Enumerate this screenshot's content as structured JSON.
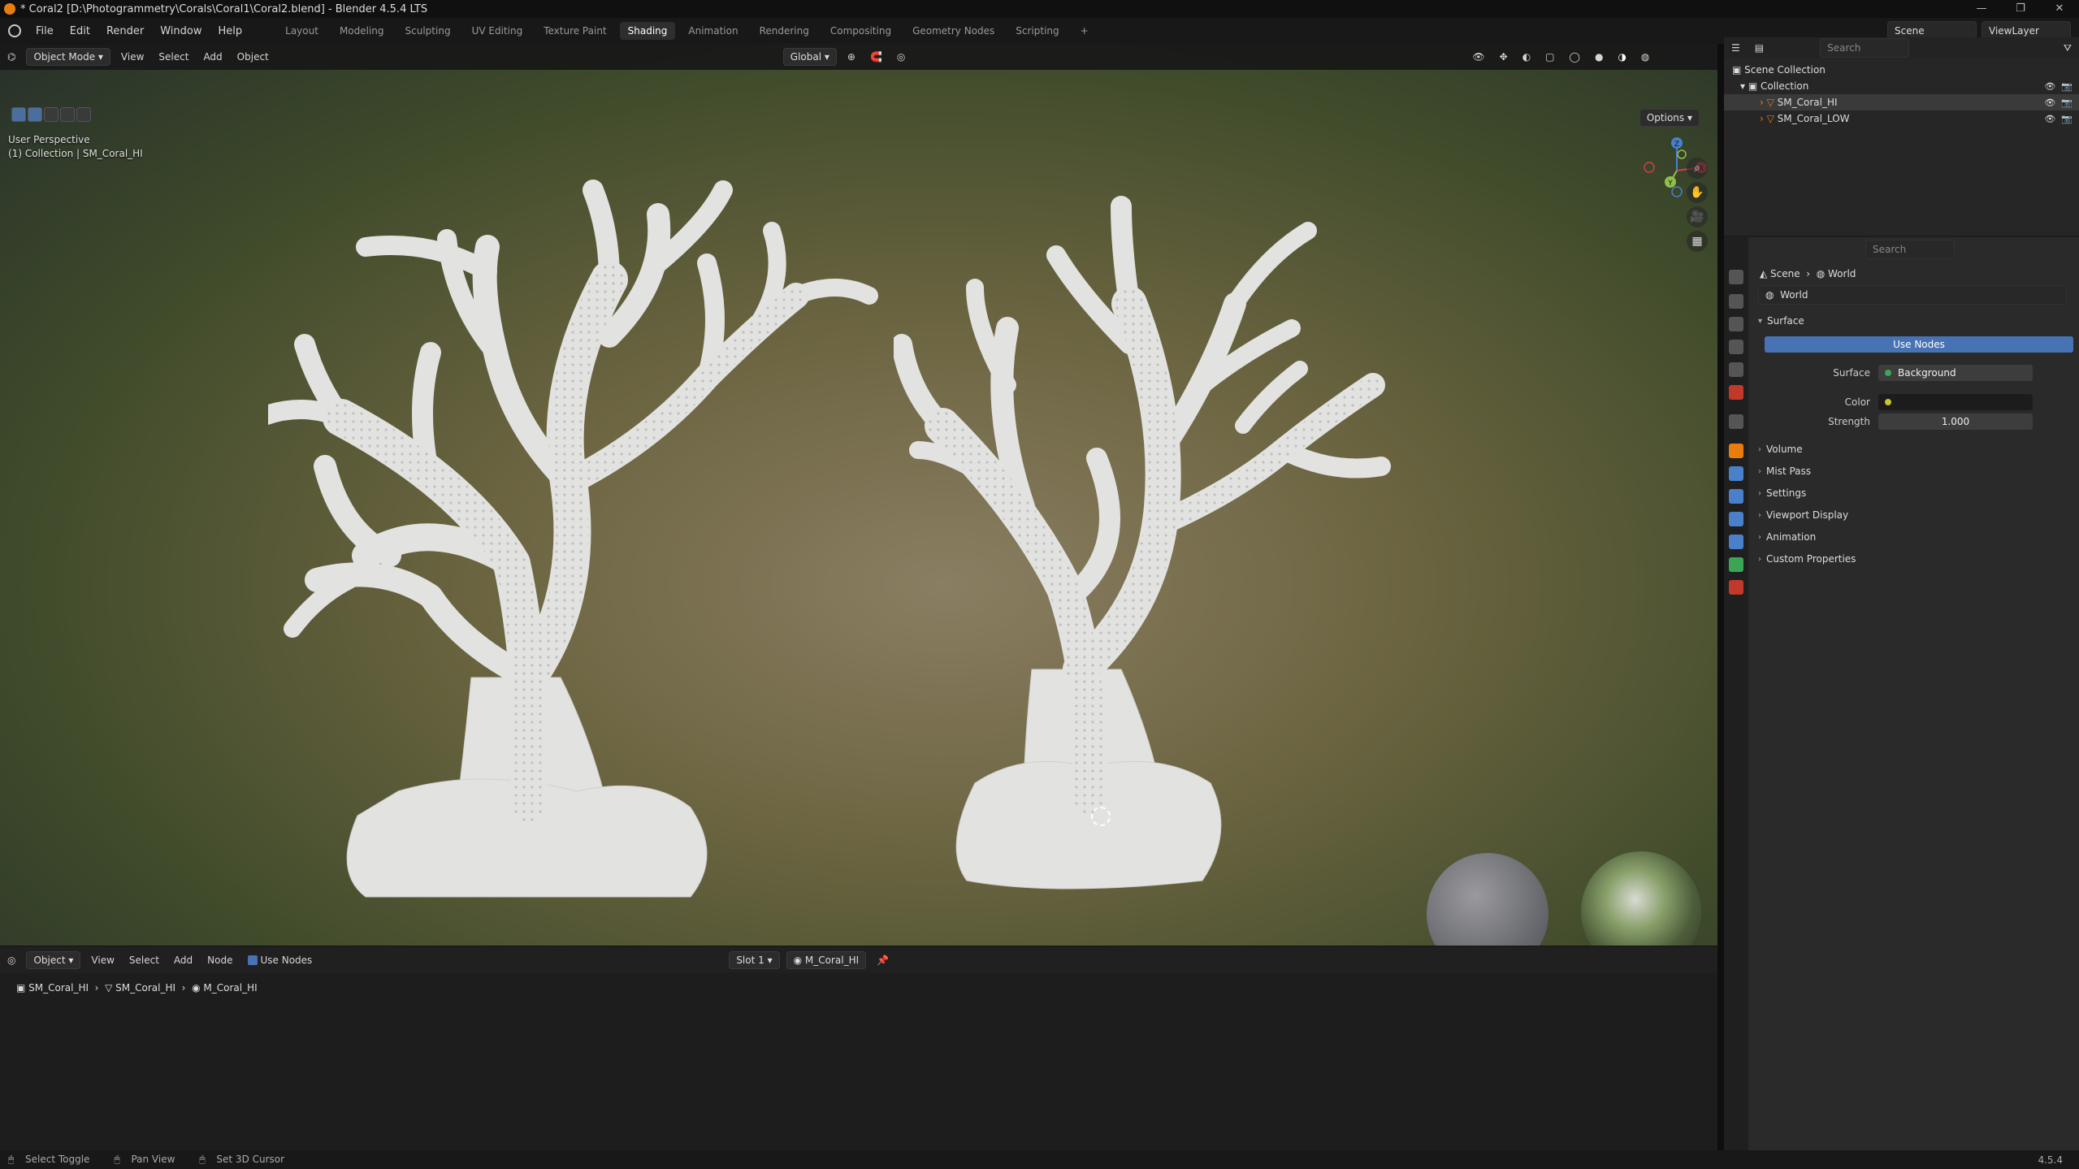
{
  "titlebar": {
    "title": "* Coral2 [D:\\Photogrammetry\\Corals\\Coral1\\Coral2.blend] - Blender 4.5.4 LTS",
    "min": "—",
    "max": "❐",
    "close": "✕"
  },
  "menu": {
    "items": [
      "File",
      "Edit",
      "Render",
      "Window",
      "Help"
    ],
    "workspaces": [
      "Layout",
      "Modeling",
      "Sculpting",
      "UV Editing",
      "Texture Paint",
      "Shading",
      "Animation",
      "Rendering",
      "Compositing",
      "Geometry Nodes",
      "Scripting"
    ],
    "active_workspace": "Shading",
    "add_workspace": "+",
    "scene": "Scene",
    "view_layer": "ViewLayer"
  },
  "viewport": {
    "mode": "Object Mode",
    "menus": [
      "View",
      "Select",
      "Add",
      "Object"
    ],
    "orientation": "Global",
    "options": "Options",
    "info_line1": "User Perspective",
    "info_line2": "(1) Collection | SM_Coral_HI"
  },
  "node_editor": {
    "type": "Object",
    "menus": [
      "View",
      "Select",
      "Add",
      "Node"
    ],
    "use_nodes": "Use Nodes",
    "slot": "Slot 1",
    "material": "M_Coral_HI",
    "breadcrumb": [
      "SM_Coral_HI",
      "SM_Coral_HI",
      "M_Coral_HI"
    ]
  },
  "outliner": {
    "search_placeholder": "Search",
    "scene_collection": "Scene Collection",
    "collection": "Collection",
    "objects": [
      "SM_Coral_HI",
      "SM_Coral_LOW"
    ]
  },
  "properties": {
    "search_placeholder": "Search",
    "breadcrumb_scene": "Scene",
    "breadcrumb_world": "World",
    "world_name": "World",
    "surface_panel": "Surface",
    "use_nodes": "Use Nodes",
    "surface_label": "Surface",
    "surface_value": "Background",
    "color_label": "Color",
    "strength_label": "Strength",
    "strength_value": "1.000",
    "panels": [
      "Volume",
      "Mist Pass",
      "Settings",
      "Viewport Display",
      "Animation",
      "Custom Properties"
    ]
  },
  "statusbar": {
    "items": [
      "Select Toggle",
      "Pan View",
      "Set 3D Cursor"
    ],
    "version": "4.5.4"
  },
  "colors": {
    "accent": "#4772b3",
    "active_tab": "#e87d0d",
    "color_socket": "#c7c729"
  }
}
